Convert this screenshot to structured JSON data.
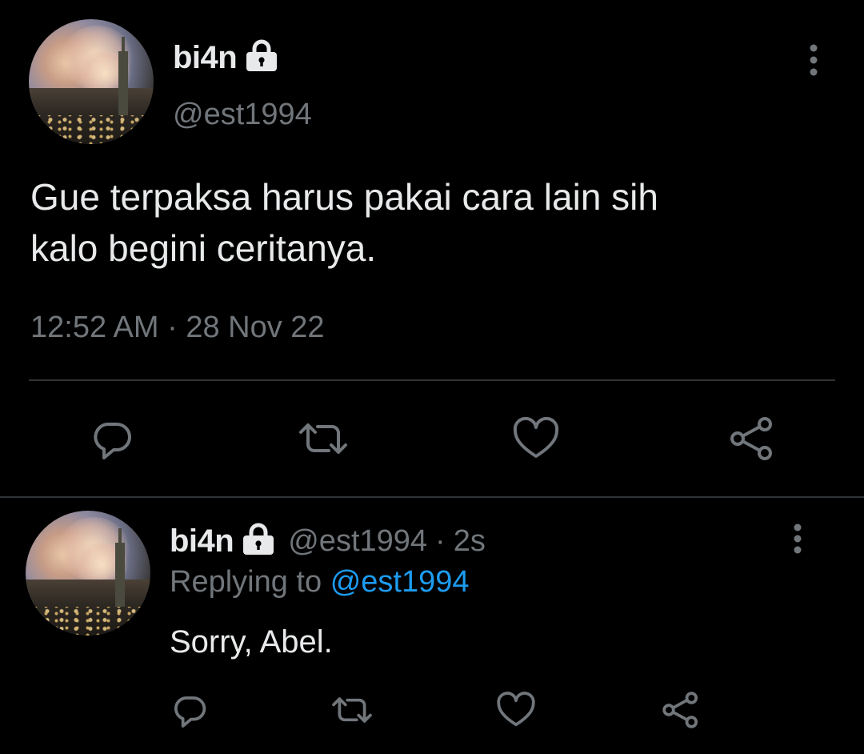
{
  "main_tweet": {
    "display_name": "bi4n",
    "handle": "@est1994",
    "text_line1": "Gue terpaksa harus pakai cara lain sih",
    "text_line2": "kalo begini ceritanya.",
    "timestamp": "12:52 AM · 28 Nov 22",
    "icons": {
      "lock": "lock-icon",
      "more": "more-vertical-icon",
      "reply": "reply-icon",
      "retweet": "retweet-icon",
      "like": "heart-icon",
      "share": "share-icon"
    }
  },
  "reply_tweet": {
    "display_name": "bi4n",
    "handle": "@est1994",
    "separator": "·",
    "time_ago": "2s",
    "replying_prefix": "Replying to",
    "replying_to": "@est1994",
    "text": "Sorry, Abel."
  },
  "colors": {
    "background": "#000000",
    "text": "#e7e9ea",
    "secondary": "#71767b",
    "link": "#1d9bf0",
    "divider": "#2f3336"
  }
}
